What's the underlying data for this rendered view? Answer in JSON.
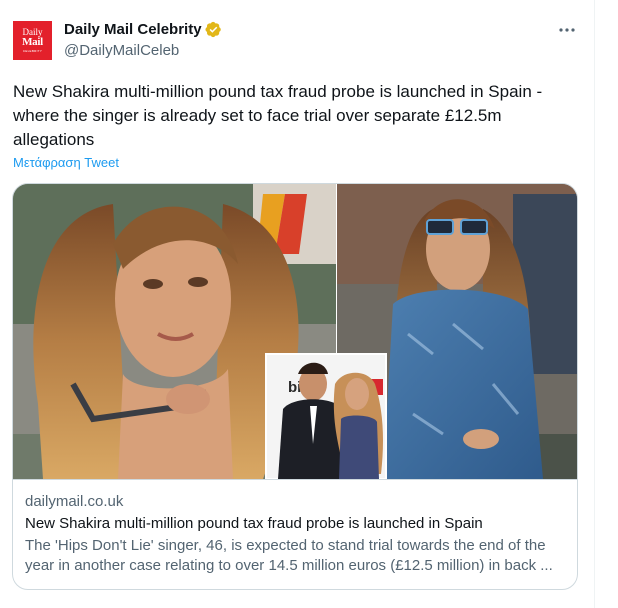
{
  "author": {
    "display_name": "Daily Mail Celebrity",
    "handle": "@DailyMailCeleb",
    "avatar_lines": [
      "Daily",
      "Mail",
      "CELEBRITY"
    ],
    "verified_icon": "verified-badge-icon",
    "verified_color": "#f4b400"
  },
  "tweet": {
    "text": "New Shakira multi-million pound tax fraud probe is launched in Spain - where the singer is already set to face trial over separate £12.5m allegations",
    "translate_label": "Μετάφραση Tweet"
  },
  "more_icon": "more-horizontal-icon",
  "card": {
    "domain": "dailymail.co.uk",
    "title": "New Shakira multi-million pound tax fraud probe is launched in Spain",
    "description": "The 'Hips Don't Lie' singer, 46, is expected to stand trial towards the end of the year in another case relating to over 14.5 million euros (£12.5 million) in back ...",
    "image_inset_text": "billb"
  },
  "colors": {
    "link": "#1d9bf0",
    "secondary_text": "#536471",
    "border": "#cfd9de",
    "brand_red": "#e3202b"
  }
}
